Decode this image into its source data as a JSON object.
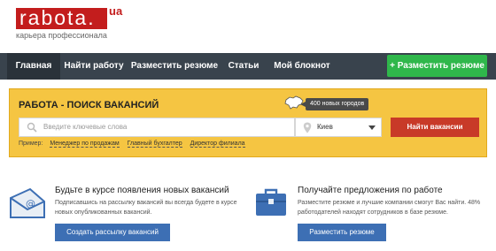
{
  "header": {
    "logo": "rabota.",
    "logo_suffix": "ua",
    "tagline": "карьера профессионала"
  },
  "nav": {
    "items": [
      "Главная",
      "Найти работу",
      "Разместить резюме",
      "Статьи",
      "Мой блокнот"
    ],
    "cta": "+ Разместить резюме"
  },
  "search": {
    "title": "РАБОТА - ПОИСК ВАКАНСИЙ",
    "cities_badge": "400 новых городов",
    "placeholder": "Введите ключевые слова",
    "city": "Киев",
    "button": "Найти вакансии",
    "example_label": "Пример:",
    "examples": [
      "Менеджер по продажам",
      "Главный бухгалтер",
      "Директор филиала"
    ]
  },
  "promos": {
    "left": {
      "title": "Будьте в курсе появления новых вакансий",
      "text": "Подписавшись на рассылку вакансий вы всегда будете в курсе новых опубликованных вакансий.",
      "button": "Создать рассылку вакансий"
    },
    "right": {
      "title": "Получайте предложения по работе",
      "text": "Разместите резюме и лучшие компании смогут Вас найти. 48% работодателей находят сотрудников в базе резюме.",
      "button": "Разместить резюме"
    }
  },
  "colors": {
    "brand_red": "#c31d1d",
    "nav_bg": "#39434d",
    "cta_green": "#2fb74b",
    "search_yellow": "#f5c542",
    "search_button": "#c83a28",
    "promo_button": "#3d6fb4"
  }
}
